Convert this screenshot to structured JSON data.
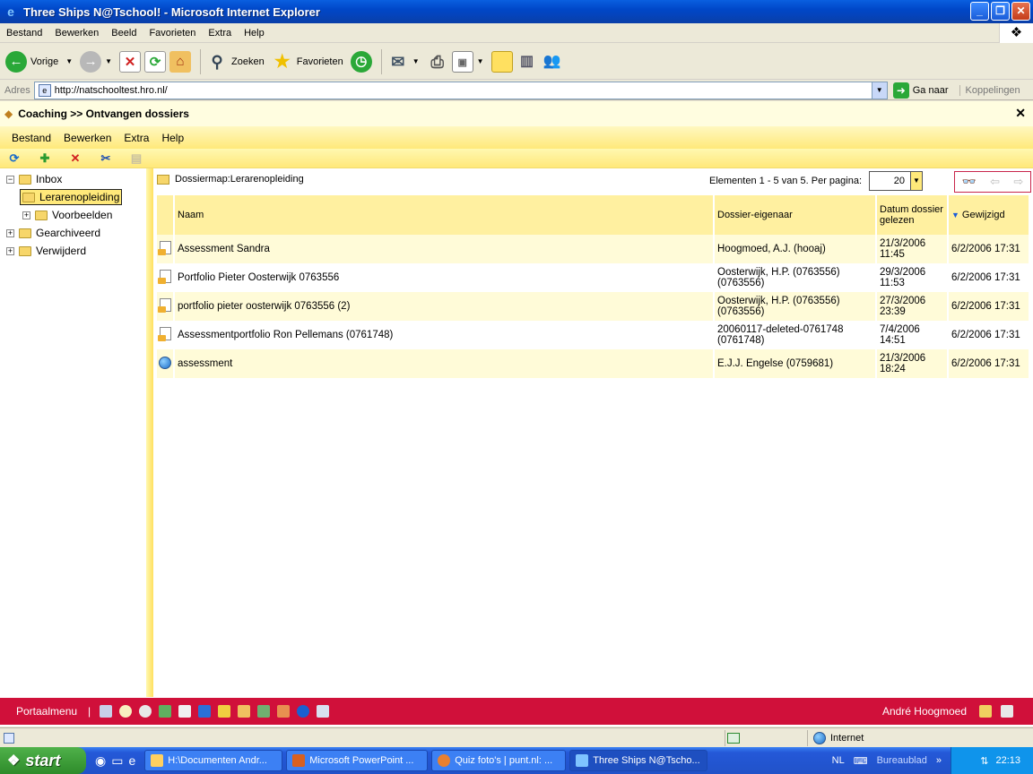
{
  "window": {
    "title": "Three Ships N@Tschool! - Microsoft Internet Explorer"
  },
  "ie_menu": [
    "Bestand",
    "Bewerken",
    "Beeld",
    "Favorieten",
    "Extra",
    "Help"
  ],
  "toolbar": {
    "back": "Vorige",
    "search": "Zoeken",
    "favorites": "Favorieten"
  },
  "address": {
    "label": "Adres",
    "url": "http://natschooltest.hro.nl/",
    "go": "Ga naar",
    "links": "Koppelingen"
  },
  "app": {
    "title": "Coaching >> Ontvangen dossiers",
    "menu": [
      "Bestand",
      "Bewerken",
      "Extra",
      "Help"
    ]
  },
  "tree": {
    "inbox": "Inbox",
    "lerarenopleiding": "Lerarenopleiding",
    "voorbeelden": "Voorbeelden",
    "gearchiveerd": "Gearchiveerd",
    "verwijderd": "Verwijderd"
  },
  "main": {
    "breadcrumb": "Dossiermap:Lerarenopleiding",
    "pager_text": "Elementen 1 - 5 van 5. Per pagina:",
    "page_size": "20",
    "columns": {
      "naam": "Naam",
      "eigenaar": "Dossier-eigenaar",
      "datum": "Datum dossier gelezen",
      "gewijzigd": "Gewijzigd"
    },
    "rows": [
      {
        "naam": "Assessment Sandra",
        "eigenaar": "Hoogmoed, A.J. (hooaj)",
        "datum": "21/3/2006 11:45",
        "gewijzigd": "6/2/2006 17:31"
      },
      {
        "naam": "Portfolio Pieter Oosterwijk 0763556",
        "eigenaar": "Oosterwijk, H.P. (0763556) (0763556)",
        "datum": "29/3/2006 11:53",
        "gewijzigd": "6/2/2006 17:31"
      },
      {
        "naam": "portfolio pieter oosterwijk 0763556 (2)",
        "eigenaar": "Oosterwijk, H.P. (0763556) (0763556)",
        "datum": "27/3/2006 23:39",
        "gewijzigd": "6/2/2006 17:31"
      },
      {
        "naam": "Assessmentportfolio Ron Pellemans (0761748)",
        "eigenaar": "20060117-deleted-0761748 (0761748)",
        "datum": "7/4/2006 14:51",
        "gewijzigd": "6/2/2006 17:31"
      },
      {
        "naam": "assessment",
        "eigenaar": "E.J.J. Engelse (0759681)",
        "datum": "21/3/2006 18:24",
        "gewijzigd": "6/2/2006 17:31"
      }
    ]
  },
  "footer": {
    "portaalmenu": "Portaalmenu",
    "separator": "|",
    "user": "André Hoogmoed"
  },
  "status": {
    "zone": "Internet"
  },
  "taskbar": {
    "start": "start",
    "tasks": [
      "H:\\Documenten Andr...",
      "Microsoft PowerPoint ...",
      "Quiz foto's | punt.nl: ...",
      "Three Ships N@Tscho..."
    ],
    "lang": "NL",
    "desktop": "Bureaublad",
    "clock": "22:13"
  },
  "colors": {
    "accent_red": "#d0103a",
    "accent_yellow": "#ffe97a",
    "xp_blue": "#0a5fe0"
  }
}
